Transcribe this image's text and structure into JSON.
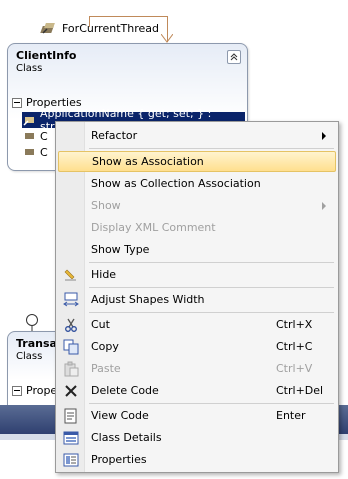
{
  "diagram": {
    "association_label": "ForCurrentThread",
    "client_info": {
      "title": "ClientInfo",
      "stereotype": "Class",
      "section_label": "Properties",
      "selected_member": "ApplicationName { get; set; } : string",
      "partial_members": [
        "C",
        "C"
      ]
    },
    "transaction": {
      "title_partial": "Transa",
      "stereotype": "Class",
      "section_label_partial": "Prope"
    }
  },
  "context_menu": {
    "items": [
      {
        "label": "Refactor",
        "shortcut": "",
        "submenu": true,
        "disabled": false,
        "icon": ""
      },
      {
        "label": "Show as Association",
        "shortcut": "",
        "submenu": false,
        "disabled": false,
        "icon": "",
        "highlighted": true
      },
      {
        "label": "Show as Collection Association",
        "shortcut": "",
        "submenu": false,
        "disabled": false,
        "icon": ""
      },
      {
        "label": "Show",
        "shortcut": "",
        "submenu": true,
        "disabled": true,
        "icon": ""
      },
      {
        "label": "Display XML Comment",
        "shortcut": "",
        "submenu": false,
        "disabled": true,
        "icon": ""
      },
      {
        "label": "Show Type",
        "shortcut": "",
        "submenu": false,
        "disabled": false,
        "icon": ""
      },
      {
        "label": "Hide",
        "shortcut": "",
        "submenu": false,
        "disabled": false,
        "icon": "hide-icon"
      },
      {
        "label": "Adjust Shapes Width",
        "shortcut": "",
        "submenu": false,
        "disabled": false,
        "icon": "adjust-width-icon"
      },
      {
        "label": "Cut",
        "shortcut": "Ctrl+X",
        "submenu": false,
        "disabled": false,
        "icon": "scissors-icon"
      },
      {
        "label": "Copy",
        "shortcut": "Ctrl+C",
        "submenu": false,
        "disabled": false,
        "icon": "copy-icon"
      },
      {
        "label": "Paste",
        "shortcut": "Ctrl+V",
        "submenu": false,
        "disabled": true,
        "icon": "paste-icon"
      },
      {
        "label": "Delete Code",
        "shortcut": "Ctrl+Del",
        "submenu": false,
        "disabled": false,
        "icon": "delete-x-icon"
      },
      {
        "label": "View Code",
        "shortcut": "Enter",
        "submenu": false,
        "disabled": false,
        "icon": "view-code-icon"
      },
      {
        "label": "Class Details",
        "shortcut": "",
        "submenu": false,
        "disabled": false,
        "icon": "class-details-icon"
      },
      {
        "label": "Properties",
        "shortcut": "",
        "submenu": false,
        "disabled": false,
        "icon": "properties-icon"
      }
    ]
  }
}
